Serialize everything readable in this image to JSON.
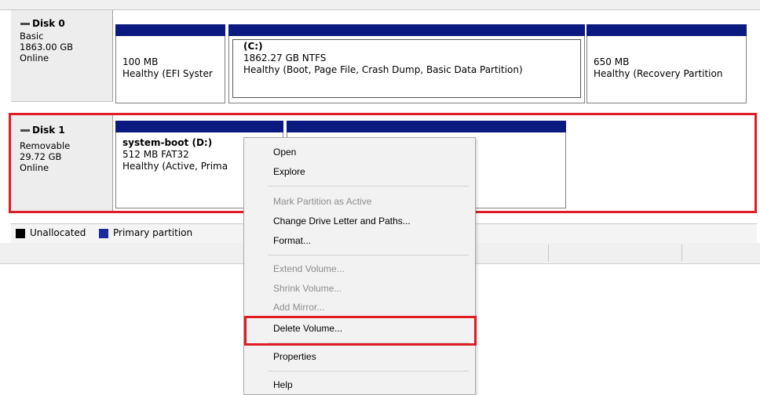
{
  "disks": [
    {
      "name": "Disk 0",
      "type": "Basic",
      "size": "1863.00 GB",
      "status": "Online",
      "partitions": [
        {
          "line1": "",
          "line2": "100 MB",
          "line3": "Healthy (EFI Syster"
        },
        {
          "line1": "(C:)",
          "line2": "1862.27 GB NTFS",
          "line3": "Healthy (Boot, Page File, Crash Dump, Basic Data Partition)"
        },
        {
          "line1": "",
          "line2": "650 MB",
          "line3": "Healthy (Recovery Partition"
        }
      ]
    },
    {
      "name": "Disk 1",
      "type": "Removable",
      "size": "29.72 GB",
      "status": "Online",
      "partitions": [
        {
          "line1": "system-boot  (D:)",
          "line2": "512 MB FAT32",
          "line3": "Healthy (Active, Prima"
        },
        {
          "line1": "",
          "line2": "",
          "line3": ""
        }
      ]
    }
  ],
  "legend": [
    {
      "label": "Unallocated",
      "color": "#000000"
    },
    {
      "label": "Primary partition",
      "color": "#1a2a9c"
    }
  ],
  "context_menu": {
    "items": [
      {
        "label": "Open",
        "enabled": true
      },
      {
        "label": "Explore",
        "enabled": true
      },
      {
        "label": "Mark Partition as Active",
        "enabled": false
      },
      {
        "label": "Change Drive Letter and Paths...",
        "enabled": true
      },
      {
        "label": "Format...",
        "enabled": true
      },
      {
        "label": "Extend Volume...",
        "enabled": false
      },
      {
        "label": "Shrink Volume...",
        "enabled": false
      },
      {
        "label": "Add Mirror...",
        "enabled": false
      },
      {
        "label": "Delete Volume...",
        "enabled": true
      },
      {
        "label": "Properties",
        "enabled": true
      },
      {
        "label": "Help",
        "enabled": true
      }
    ]
  },
  "colors": {
    "partition_bar": "#0a1a80",
    "highlight": "#e01c24"
  }
}
